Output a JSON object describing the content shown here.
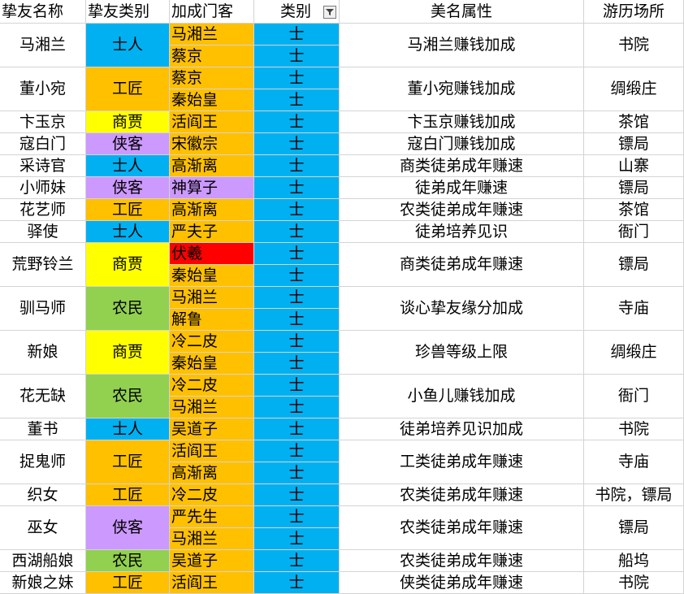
{
  "colors": {
    "blue": "#00b0f0",
    "orange": "#ffc000",
    "yellow": "#ffff00",
    "purple": "#cc99ff",
    "green": "#92d050",
    "red": "#ff0000",
    "white": "#ffffff"
  },
  "headers": [
    "挚友名称",
    "挚友类别",
    "加成门客",
    "类别",
    "美名属性",
    "游历场所"
  ],
  "filter_icon": "filter-funnel-icon",
  "rows": [
    {
      "name": "马湘兰",
      "cat": "士人",
      "catColor": "blue",
      "guests": [
        {
          "n": "马湘兰",
          "c": "orange"
        },
        {
          "n": "蔡京",
          "c": "orange"
        }
      ],
      "attr": "马湘兰赚钱加成",
      "place": "书院"
    },
    {
      "name": "董小宛",
      "cat": "工匠",
      "catColor": "orange",
      "guests": [
        {
          "n": "蔡京",
          "c": "orange"
        },
        {
          "n": "秦始皇",
          "c": "orange"
        }
      ],
      "attr": "董小宛赚钱加成",
      "place": "绸缎庄"
    },
    {
      "name": "卞玉京",
      "cat": "商贾",
      "catColor": "yellow",
      "guests": [
        {
          "n": "活阎王",
          "c": "orange"
        }
      ],
      "attr": "卞玉京赚钱加成",
      "place": "茶馆"
    },
    {
      "name": "寇白门",
      "cat": "侠客",
      "catColor": "purple",
      "guests": [
        {
          "n": "宋徽宗",
          "c": "orange"
        }
      ],
      "attr": "寇白门赚钱加成",
      "place": "镖局"
    },
    {
      "name": "采诗官",
      "cat": "士人",
      "catColor": "blue",
      "guests": [
        {
          "n": "高渐离",
          "c": "orange"
        }
      ],
      "attr": "商类徒弟成年赚速",
      "place": "山寨"
    },
    {
      "name": "小师妹",
      "cat": "侠客",
      "catColor": "purple",
      "guests": [
        {
          "n": "神算子",
          "c": "purple"
        }
      ],
      "attr": "徒弟成年赚速",
      "place": "镖局"
    },
    {
      "name": "花艺师",
      "cat": "工匠",
      "catColor": "orange",
      "guests": [
        {
          "n": "高渐离",
          "c": "orange"
        }
      ],
      "attr": "农类徒弟成年赚速",
      "place": "茶馆"
    },
    {
      "name": "驿使",
      "cat": "士人",
      "catColor": "blue",
      "guests": [
        {
          "n": "严夫子",
          "c": "orange"
        }
      ],
      "attr": "徒弟培养见识",
      "place": "衙门"
    },
    {
      "name": "荒野铃兰",
      "cat": "商贾",
      "catColor": "yellow",
      "guests": [
        {
          "n": "伏羲",
          "c": "red"
        },
        {
          "n": "秦始皇",
          "c": "orange"
        }
      ],
      "attr": "商类徒弟成年赚速",
      "place": "镖局"
    },
    {
      "name": "驯马师",
      "cat": "农民",
      "catColor": "green",
      "guests": [
        {
          "n": "马湘兰",
          "c": "orange"
        },
        {
          "n": "解鲁",
          "c": "orange"
        }
      ],
      "attr": "谈心挚友缘分加成",
      "place": "寺庙"
    },
    {
      "name": "新娘",
      "cat": "商贾",
      "catColor": "yellow",
      "guests": [
        {
          "n": "冷二皮",
          "c": "orange"
        },
        {
          "n": "秦始皇",
          "c": "orange"
        }
      ],
      "attr": "珍兽等级上限",
      "place": "绸缎庄"
    },
    {
      "name": "花无缺",
      "cat": "农民",
      "catColor": "green",
      "guests": [
        {
          "n": "冷二皮",
          "c": "orange"
        },
        {
          "n": "马湘兰",
          "c": "orange"
        }
      ],
      "attr": "小鱼儿赚钱加成",
      "place": "衙门"
    },
    {
      "name": "董书",
      "cat": "士人",
      "catColor": "blue",
      "guests": [
        {
          "n": "吴道子",
          "c": "orange"
        }
      ],
      "attr": "徒弟培养见识加成",
      "place": "书院"
    },
    {
      "name": "捉鬼师",
      "cat": "工匠",
      "catColor": "orange",
      "guests": [
        {
          "n": "活阎王",
          "c": "orange"
        },
        {
          "n": "高渐离",
          "c": "orange"
        }
      ],
      "attr": "工类徒弟成年赚速",
      "place": "寺庙"
    },
    {
      "name": "织女",
      "cat": "工匠",
      "catColor": "orange",
      "guests": [
        {
          "n": "冷二皮",
          "c": "orange"
        }
      ],
      "attr": "农类徒弟成年赚速",
      "place": "书院，镖局"
    },
    {
      "name": "巫女",
      "cat": "侠客",
      "catColor": "purple",
      "guests": [
        {
          "n": "严先生",
          "c": "orange"
        },
        {
          "n": "马湘兰",
          "c": "orange"
        }
      ],
      "attr": "农类徒弟成年赚速",
      "place": "镖局"
    },
    {
      "name": "西湖船娘",
      "cat": "农民",
      "catColor": "green",
      "guests": [
        {
          "n": "吴道子",
          "c": "orange"
        }
      ],
      "attr": "农类徒弟成年赚速",
      "place": "船坞"
    },
    {
      "name": "新娘之妹",
      "cat": "工匠",
      "catColor": "orange",
      "guests": [
        {
          "n": "活阎王",
          "c": "orange"
        }
      ],
      "attr": "侠类徒弟成年赚速",
      "place": "书院"
    }
  ],
  "type_label": "士",
  "type_color": "blue"
}
